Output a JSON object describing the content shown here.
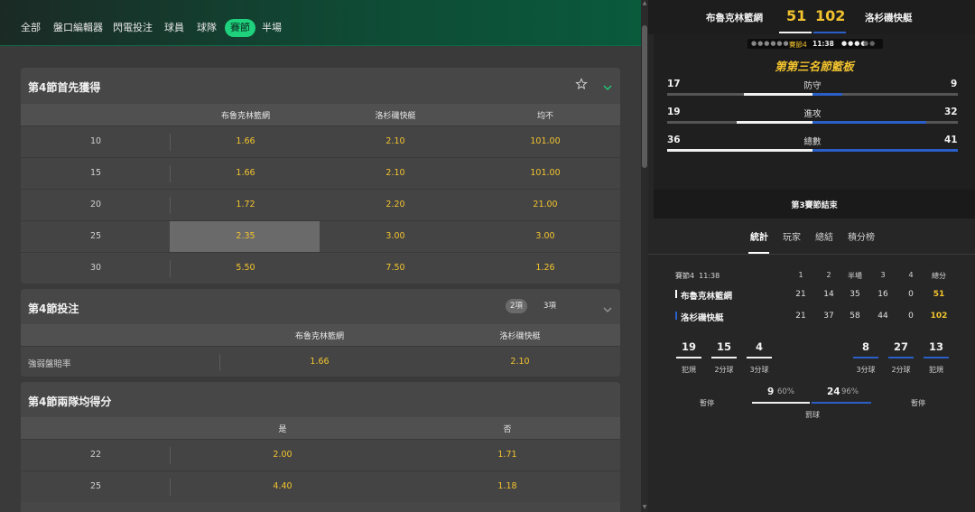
{
  "nav": {
    "items": [
      "全部",
      "盤口編輯器",
      "閃電投注",
      "球員",
      "球隊",
      "賽節",
      "半場"
    ],
    "active_index": 5
  },
  "markets": {
    "first_score": {
      "title": "第4節首先獲得",
      "headers": [
        "布魯克林籃網",
        "洛杉磯快艇",
        "均不"
      ],
      "rows": [
        {
          "label": "10",
          "odds": [
            "1.66",
            "2.10",
            "101.00"
          ]
        },
        {
          "label": "15",
          "odds": [
            "1.66",
            "2.10",
            "101.00"
          ]
        },
        {
          "label": "20",
          "odds": [
            "1.72",
            "2.20",
            "21.00"
          ]
        },
        {
          "label": "25",
          "odds": [
            "2.35",
            "3.00",
            "3.00"
          ]
        },
        {
          "label": "30",
          "odds": [
            "5.50",
            "7.50",
            "1.26"
          ]
        }
      ],
      "selected": {
        "row": 3,
        "col": 0
      }
    },
    "quarter_bet": {
      "title": "第4節投注",
      "pill_2": "2項",
      "pill_3": "3項",
      "headers": [
        "布魯克林籃網",
        "洛杉磯快艇"
      ],
      "row": {
        "label": "強弱盤賠率",
        "odds": [
          "1.66",
          "2.10"
        ]
      }
    },
    "both_score": {
      "title": "第4節兩隊均得分",
      "headers": [
        "是",
        "否"
      ],
      "rows": [
        {
          "label": "22",
          "odds": [
            "2.00",
            "1.71"
          ]
        },
        {
          "label": "25",
          "odds": [
            "4.40",
            "1.18"
          ]
        }
      ]
    }
  },
  "scoreboard": {
    "home_team": "布魯克林籃網",
    "away_team": "洛杉磯快艇",
    "home_score": "51",
    "away_score": "102",
    "period_label": "賽節4",
    "clock": "11:38",
    "sponsor_title": "第第三名節籃板",
    "stats": [
      {
        "label": "防守",
        "home": "17",
        "away": "9"
      },
      {
        "label": "進攻",
        "home": "19",
        "away": "32"
      },
      {
        "label": "總數",
        "home": "36",
        "away": "41"
      }
    ],
    "status": "第3賽節結束"
  },
  "tabs": [
    "統計",
    "玩家",
    "總結",
    "積分榜"
  ],
  "box": {
    "period_clock": "賽節4  11:38",
    "headers": [
      "1",
      "2",
      "半場",
      "3",
      "4",
      "總分"
    ],
    "rows": [
      {
        "team": "布魯克林籃網",
        "values": [
          "21",
          "14",
          "35",
          "16",
          "0"
        ],
        "total": "51",
        "color": "#ffffff"
      },
      {
        "team": "洛杉磯快艇",
        "values": [
          "21",
          "37",
          "58",
          "44",
          "0"
        ],
        "total": "102",
        "color": "#2a5ec8"
      }
    ]
  },
  "team_stats": {
    "home": [
      {
        "value": "19",
        "label": "犯規"
      },
      {
        "value": "15",
        "label": "2分球"
      },
      {
        "value": "4",
        "label": "3分球"
      }
    ],
    "away": [
      {
        "value": "8",
        "label": "3分球"
      },
      {
        "value": "27",
        "label": "2分球"
      },
      {
        "value": "13",
        "label": "犯規"
      }
    ],
    "timeout_label": "暫停",
    "free_throw": {
      "home_value": "9",
      "home_pct": "60%",
      "away_value": "24",
      "away_pct": "96%",
      "label": "罰球"
    }
  },
  "colors": {
    "accent": "#1fd17d",
    "odds": "#f2c32e",
    "away": "#2a5ec8"
  },
  "icons": {
    "favorite": "star-icon",
    "expand": "chevron-icon"
  }
}
